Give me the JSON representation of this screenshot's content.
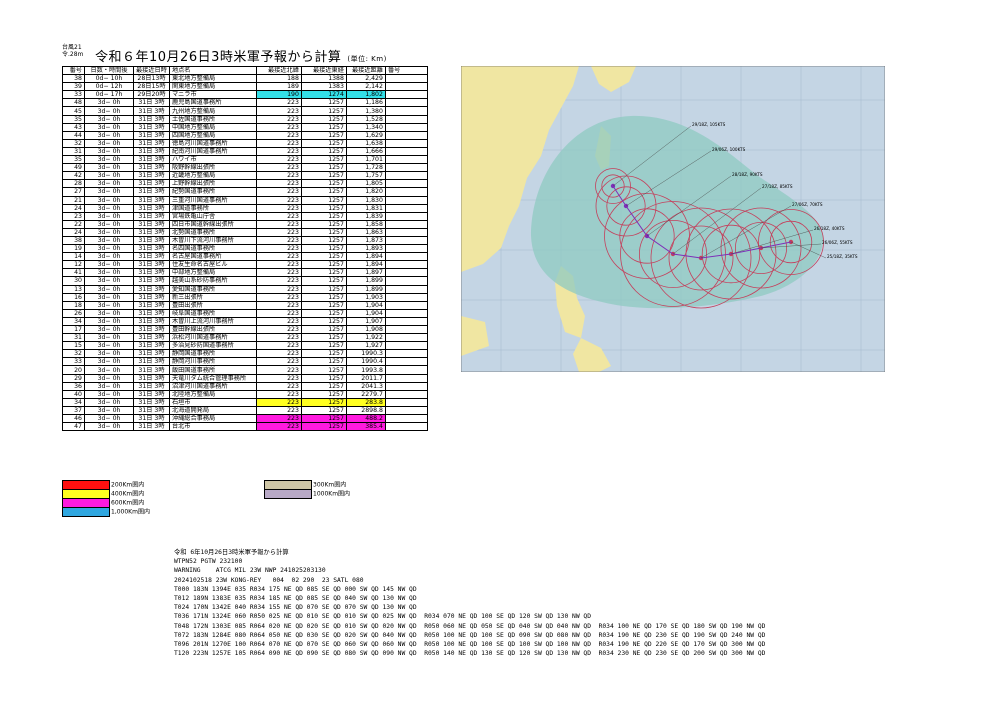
{
  "header": {
    "corner_line1": "台風21",
    "corner_line2": "令.28m",
    "title": "令和６年10月26日3時米軍予報から計算",
    "unit": "(単位: Km)"
  },
  "table": {
    "columns": [
      "番号",
      "日数・時間後",
      "最接近日時",
      "地点名",
      "最接近北緯",
      "最接近東経",
      "最接近距離",
      "番号"
    ],
    "rows": [
      {
        "no": "38",
        "elapsed": "0d− 10h",
        "time": "28日13時",
        "place": "東北地方整備局",
        "lat": "188",
        "lon": "1388",
        "dist": "2,429",
        "hl": ""
      },
      {
        "no": "39",
        "elapsed": "0d− 12h",
        "time": "28日15時",
        "place": "関東地方整備局",
        "lat": "189",
        "lon": "1383",
        "dist": "2,142",
        "hl": ""
      },
      {
        "no": "33",
        "elapsed": "0d− 17h",
        "time": "29日20時",
        "place": "マニラ市",
        "lat": "190",
        "lon": "1274",
        "dist": "1,802",
        "hl": "cyan"
      },
      {
        "no": "48",
        "elapsed": "3d− 0h",
        "time": "31日 3時",
        "place": "鹿児島国道事務所",
        "lat": "223",
        "lon": "1257",
        "dist": "1,186",
        "hl": ""
      },
      {
        "no": "45",
        "elapsed": "3d− 0h",
        "time": "31日 3時",
        "place": "九州地方整備局",
        "lat": "223",
        "lon": "1257",
        "dist": "1,380",
        "hl": ""
      },
      {
        "no": "35",
        "elapsed": "3d− 0h",
        "time": "31日 3時",
        "place": "土佐国道事務所",
        "lat": "223",
        "lon": "1257",
        "dist": "1,528",
        "hl": ""
      },
      {
        "no": "43",
        "elapsed": "3d− 0h",
        "time": "31日 3時",
        "place": "中国地方整備局",
        "lat": "223",
        "lon": "1257",
        "dist": "1,340",
        "hl": ""
      },
      {
        "no": "44",
        "elapsed": "3d− 0h",
        "time": "31日 3時",
        "place": "四国地方整備局",
        "lat": "223",
        "lon": "1257",
        "dist": "1,629",
        "hl": ""
      },
      {
        "no": "32",
        "elapsed": "3d− 0h",
        "time": "31日 3時",
        "place": "徳島河川国道事務所",
        "lat": "223",
        "lon": "1257",
        "dist": "1,638",
        "hl": ""
      },
      {
        "no": "31",
        "elapsed": "3d− 0h",
        "time": "31日 3時",
        "place": "紀南河川国道事務所",
        "lat": "223",
        "lon": "1257",
        "dist": "1,666",
        "hl": ""
      },
      {
        "no": "35",
        "elapsed": "3d− 0h",
        "time": "31日 3時",
        "place": "ハワイ市",
        "lat": "223",
        "lon": "1257",
        "dist": "1,701",
        "hl": ""
      },
      {
        "no": "49",
        "elapsed": "3d− 0h",
        "time": "31日 3時",
        "place": "阪野幹線出張所",
        "lat": "223",
        "lon": "1257",
        "dist": "1,728",
        "hl": ""
      },
      {
        "no": "42",
        "elapsed": "3d− 0h",
        "time": "31日 3時",
        "place": "近畿地方整備局",
        "lat": "223",
        "lon": "1257",
        "dist": "1,757",
        "hl": ""
      },
      {
        "no": "28",
        "elapsed": "3d− 0h",
        "time": "31日 3時",
        "place": "上野幹線出張所",
        "lat": "223",
        "lon": "1257",
        "dist": "1,805",
        "hl": ""
      },
      {
        "no": "27",
        "elapsed": "3d− 0h",
        "time": "31日 3時",
        "place": "紀勢国道事務所",
        "lat": "223",
        "lon": "1257",
        "dist": "1,820",
        "hl": ""
      },
      {
        "no": "21",
        "elapsed": "3d− 0h",
        "time": "31日 3時",
        "place": "三重河川国道事務所",
        "lat": "223",
        "lon": "1257",
        "dist": "1,830",
        "hl": ""
      },
      {
        "no": "24",
        "elapsed": "3d− 0h",
        "time": "31日 3時",
        "place": "津国道事務所",
        "lat": "223",
        "lon": "1257",
        "dist": "1,831",
        "hl": ""
      },
      {
        "no": "23",
        "elapsed": "3d− 0h",
        "time": "31日 3時",
        "place": "宮場鉄亀山庁舎",
        "lat": "223",
        "lon": "1257",
        "dist": "1,839",
        "hl": ""
      },
      {
        "no": "22",
        "elapsed": "3d− 0h",
        "time": "31日 3時",
        "place": "四日市国道幹線出張所",
        "lat": "223",
        "lon": "1257",
        "dist": "1,858",
        "hl": ""
      },
      {
        "no": "24",
        "elapsed": "3d− 0h",
        "time": "31日 3時",
        "place": "北勢国道事務所",
        "lat": "223",
        "lon": "1257",
        "dist": "1,863",
        "hl": ""
      },
      {
        "no": "38",
        "elapsed": "3d− 0h",
        "time": "31日 3時",
        "place": "木曽川下流河川事務所",
        "lat": "223",
        "lon": "1257",
        "dist": "1,873",
        "hl": ""
      },
      {
        "no": "19",
        "elapsed": "3d− 0h",
        "time": "31日 3時",
        "place": "名四国道事務所",
        "lat": "223",
        "lon": "1257",
        "dist": "1,893",
        "hl": ""
      },
      {
        "no": "14",
        "elapsed": "3d− 0h",
        "time": "31日 3時",
        "place": "名古屋国道事務所",
        "lat": "223",
        "lon": "1257",
        "dist": "1,894",
        "hl": ""
      },
      {
        "no": "12",
        "elapsed": "3d− 0h",
        "time": "31日 3時",
        "place": "住友生命名古屋ビル",
        "lat": "223",
        "lon": "1257",
        "dist": "1,894",
        "hl": ""
      },
      {
        "no": "41",
        "elapsed": "3d− 0h",
        "time": "31日 3時",
        "place": "中部地方整備局",
        "lat": "223",
        "lon": "1257",
        "dist": "1,897",
        "hl": ""
      },
      {
        "no": "30",
        "elapsed": "3d− 0h",
        "time": "31日 3時",
        "place": "越美山系砂防事務所",
        "lat": "223",
        "lon": "1257",
        "dist": "1,899",
        "hl": ""
      },
      {
        "no": "13",
        "elapsed": "3d− 0h",
        "time": "31日 3時",
        "place": "愛知国道事務所",
        "lat": "223",
        "lon": "1257",
        "dist": "1,899",
        "hl": ""
      },
      {
        "no": "16",
        "elapsed": "3d− 0h",
        "time": "31日 3時",
        "place": "新三出張所",
        "lat": "223",
        "lon": "1257",
        "dist": "1,903",
        "hl": ""
      },
      {
        "no": "18",
        "elapsed": "3d− 0h",
        "time": "31日 3時",
        "place": "豊田出張所",
        "lat": "223",
        "lon": "1257",
        "dist": "1,904",
        "hl": ""
      },
      {
        "no": "26",
        "elapsed": "3d− 0h",
        "time": "31日 3時",
        "place": "岐阜国道事務所",
        "lat": "223",
        "lon": "1257",
        "dist": "1,904",
        "hl": ""
      },
      {
        "no": "34",
        "elapsed": "3d− 0h",
        "time": "31日 3時",
        "place": "木曽川上流河川事務所",
        "lat": "223",
        "lon": "1257",
        "dist": "1,907",
        "hl": ""
      },
      {
        "no": "17",
        "elapsed": "3d− 0h",
        "time": "31日 3時",
        "place": "豊田幹線出張所",
        "lat": "223",
        "lon": "1257",
        "dist": "1,908",
        "hl": ""
      },
      {
        "no": "31",
        "elapsed": "3d− 0h",
        "time": "31日 3時",
        "place": "浜松河川国道事務所",
        "lat": "223",
        "lon": "1257",
        "dist": "1,922",
        "hl": ""
      },
      {
        "no": "15",
        "elapsed": "3d− 0h",
        "time": "31日 3時",
        "place": "多治見砂防国道事務所",
        "lat": "223",
        "lon": "1257",
        "dist": "1,927",
        "hl": ""
      },
      {
        "no": "32",
        "elapsed": "3d− 0h",
        "time": "31日 3時",
        "place": "静岡国道事務所",
        "lat": "223",
        "lon": "1257",
        "dist": "1990.3",
        "hl": ""
      },
      {
        "no": "33",
        "elapsed": "3d− 0h",
        "time": "31日 3時",
        "place": "静岡河川事務所",
        "lat": "223",
        "lon": "1257",
        "dist": "1990.4",
        "hl": ""
      },
      {
        "no": "20",
        "elapsed": "3d− 0h",
        "time": "31日 3時",
        "place": "飯田国道事務所",
        "lat": "223",
        "lon": "1257",
        "dist": "1993.8",
        "hl": ""
      },
      {
        "no": "29",
        "elapsed": "3d− 0h",
        "time": "31日 3時",
        "place": "天竜川ダム統合管理事務所",
        "lat": "223",
        "lon": "1257",
        "dist": "2011.7",
        "hl": ""
      },
      {
        "no": "36",
        "elapsed": "3d− 0h",
        "time": "31日 3時",
        "place": "沼津河川国道事務所",
        "lat": "223",
        "lon": "1257",
        "dist": "2041.3",
        "hl": ""
      },
      {
        "no": "40",
        "elapsed": "3d− 0h",
        "time": "31日 3時",
        "place": "北陸地方整備局",
        "lat": "223",
        "lon": "1257",
        "dist": "2279.7",
        "hl": ""
      },
      {
        "no": "34",
        "elapsed": "3d− 0h",
        "time": "31日 3時",
        "place": "石垣市",
        "lat": "223",
        "lon": "1257",
        "dist": "283.8",
        "hl": "yellow"
      },
      {
        "no": "37",
        "elapsed": "3d− 0h",
        "time": "31日 3時",
        "place": "北海道開発局",
        "lat": "223",
        "lon": "1257",
        "dist": "2898.8",
        "hl": ""
      },
      {
        "no": "46",
        "elapsed": "3d− 0h",
        "time": "31日 3時",
        "place": "沖縄総合事務局",
        "lat": "223",
        "lon": "1257",
        "dist": "488.2",
        "hl": "magenta"
      },
      {
        "no": "47",
        "elapsed": "3d− 0h",
        "time": "31日 3時",
        "place": "台北市",
        "lat": "223",
        "lon": "1257",
        "dist": "385.4",
        "hl": "magenta"
      }
    ]
  },
  "legend_left": [
    {
      "label": "200Km圏内",
      "color": "#ff1010"
    },
    {
      "label": "400Km圏内",
      "color": "#ffff20"
    },
    {
      "label": "600Km圏内",
      "color": "#ff1adf"
    },
    {
      "label": "1,000Km圏内",
      "color": "#2fa7e0"
    }
  ],
  "legend_right": [
    {
      "label": "300Km圏内",
      "color": "#cfc6a6"
    },
    {
      "label": "1000Km圏内",
      "color": "#b8a9c6"
    }
  ],
  "map": {
    "labels": [
      "29/18Z, 105KTS",
      "29/06Z, 100KTS",
      "28/18Z, 90KTS",
      "27/18Z, 85KTS",
      "27/06Z, 70KTS",
      "26/18Z, 40KTS",
      "26/06Z, 55KTS",
      "25/18Z, 35KTS"
    ],
    "colors": {
      "sea": "#c4d5e4",
      "land": "#f0e6a2",
      "swath": "#8fc9c2",
      "track": "#c4405c",
      "pos": "#7d2fb8"
    }
  },
  "bulletin": {
    "lines": [
      "令和 6年10月26日3時米軍予報から計算",
      "WTPN52 PGTW 232100",
      "WARNING    ATCG MIL 23W NWP 241025203130",
      "2024102518 23W KONG-REY   004  02 290  23 SATL 080",
      "T000 183N 1394E 035 R034 175 NE QD 085 SE QD 000 SW QD 145 NW QD",
      "T012 189N 1383E 035 R034 185 NE QD 085 SE QD 040 SW QD 130 NW QD",
      "T024 170N 1342E 040 R034 155 NE QD 070 SE QD 070 SW QD 130 NW QD",
      "T036 171N 1324E 060 R050 025 NE QD 010 SE QD 010 SW QD 025 NW QD  R034 070 NE QD 100 SE QD 120 SW QD 130 NW QD",
      "T048 172N 1303E 085 R064 020 NE QD 020 SE QD 010 SW QD 020 NW QD  R050 060 NE QD 050 SE QD 040 SW QD 040 NW QD  R034 100 NE QD 170 SE QD 180 SW QD 190 NW QD",
      "T072 183N 1284E 080 R064 050 NE QD 030 SE QD 020 SW QD 040 NW QD  R050 100 NE QD 100 SE QD 090 SW QD 080 NW QD  R034 190 NE QD 230 SE QD 190 SW QD 240 NW QD",
      "T096 201N 1270E 100 R064 070 NE QD 070 SE QD 060 SW QD 060 NW QD  R050 100 NE QD 100 SE QD 100 SW QD 100 NW QD  R034 190 NE QD 220 SE QD 170 SW QD 300 NW QD",
      "T120 223N 1257E 105 R064 090 NE QD 090 SE QD 080 SW QD 090 NW QD  R050 140 NE QD 130 SE QD 120 SW QD 130 NW QD  R034 230 NE QD 230 SE QD 200 SW QD 300 NW QD"
    ]
  }
}
